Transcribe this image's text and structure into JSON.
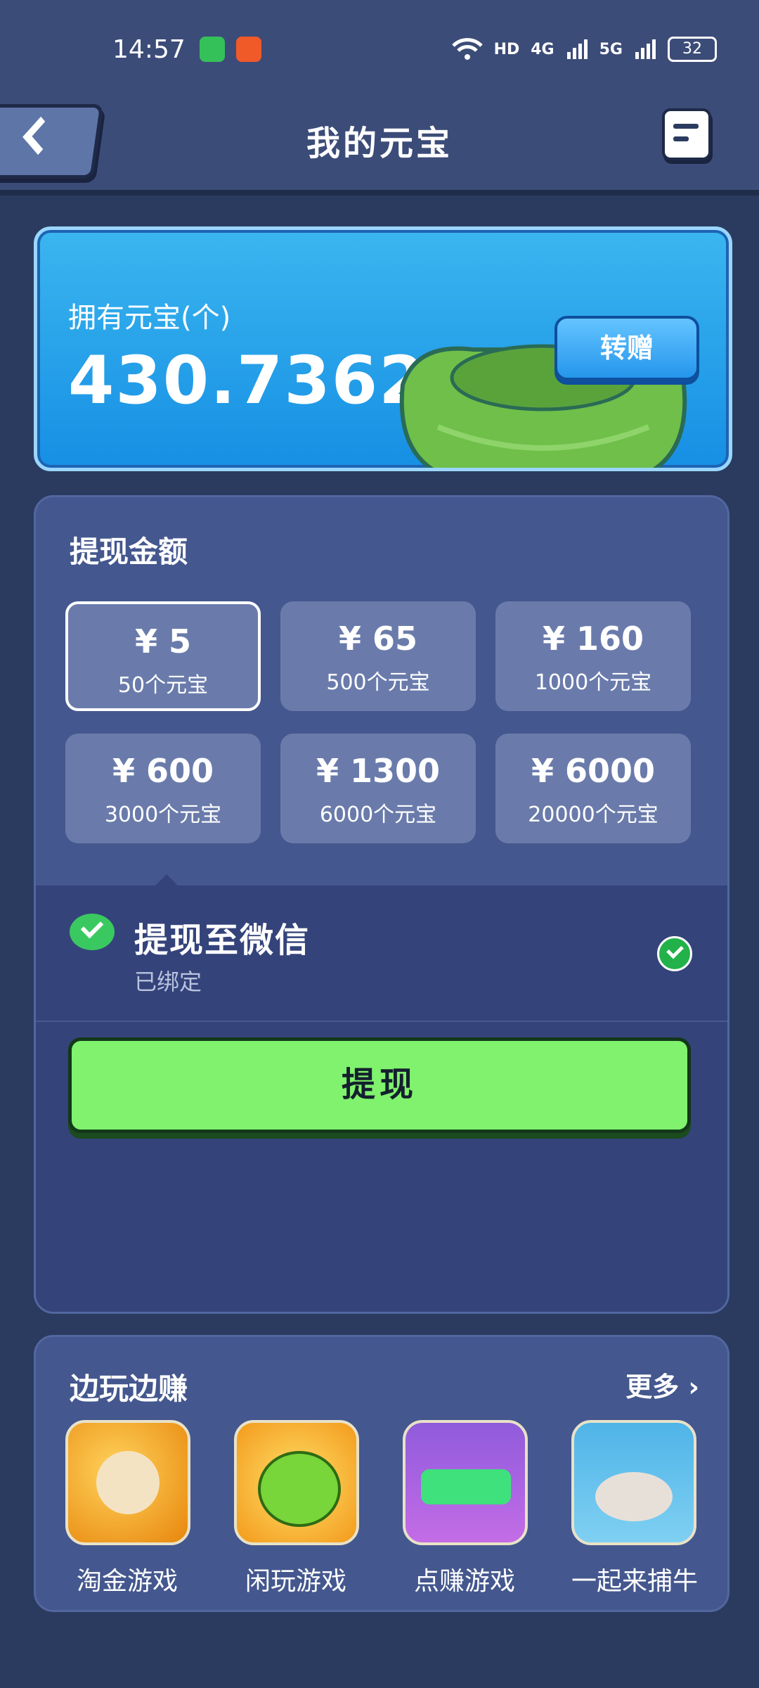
{
  "status_bar": {
    "time": "14:57",
    "network_labels": [
      "HD",
      "4G",
      "5G"
    ],
    "battery": "32"
  },
  "header": {
    "title": "我的元宝"
  },
  "balance": {
    "label": "拥有元宝(个)",
    "value": "430.7362",
    "transfer_label": "转赠"
  },
  "withdraw": {
    "title": "提现金额",
    "options": [
      {
        "price": "¥ 5",
        "cost": "50个元宝",
        "selected": true
      },
      {
        "price": "¥ 65",
        "cost": "500个元宝",
        "selected": false
      },
      {
        "price": "¥ 160",
        "cost": "1000个元宝",
        "selected": false
      },
      {
        "price": "¥ 600",
        "cost": "3000个元宝",
        "selected": false
      },
      {
        "price": "¥ 1300",
        "cost": "6000个元宝",
        "selected": false
      },
      {
        "price": "¥ 6000",
        "cost": "20000个元宝",
        "selected": false
      }
    ],
    "method_title": "提现至微信",
    "method_status": "已绑定",
    "button_label": "提现"
  },
  "earn": {
    "title": "边玩边赚",
    "more_label": "更多 ›",
    "games": [
      {
        "name": "淘金游戏"
      },
      {
        "name": "闲玩游戏"
      },
      {
        "name": "点赚游戏"
      },
      {
        "name": "一起来捕牛"
      }
    ]
  },
  "colors": {
    "background": "#2b3b60",
    "accent_blue": "#168fe4",
    "button_green": "#80f26d",
    "wechat_green": "#3ac960"
  }
}
